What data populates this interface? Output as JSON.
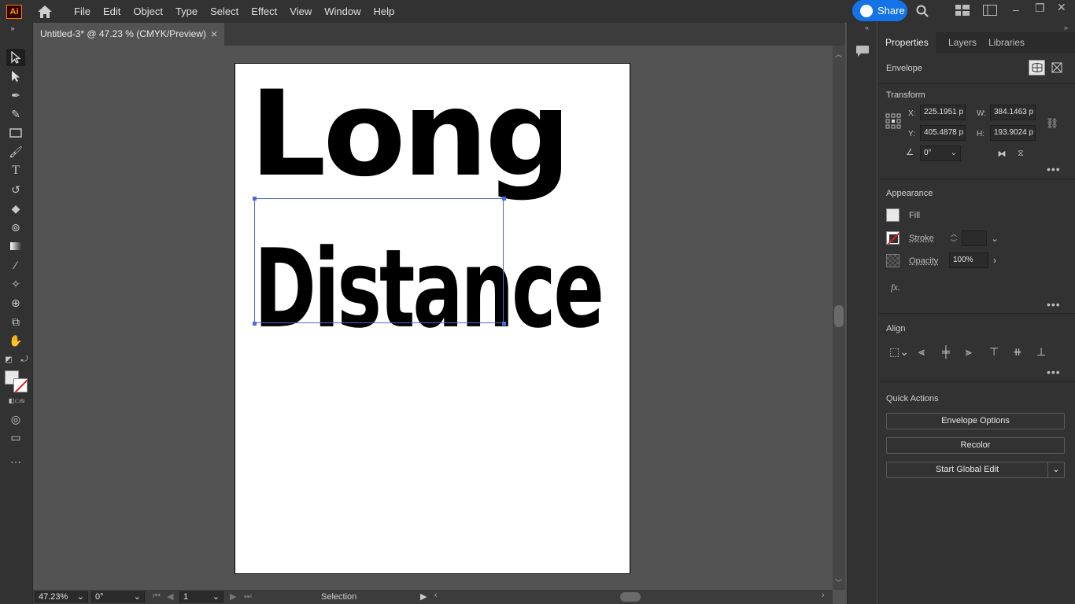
{
  "app": {
    "logo": "Ai"
  },
  "menu": [
    "File",
    "Edit",
    "Object",
    "Type",
    "Select",
    "Effect",
    "View",
    "Window",
    "Help"
  ],
  "share_label": "Share",
  "document_tab": {
    "title": "Untitled-3* @ 47.23 % (CMYK/Preview)",
    "close": "×"
  },
  "artwork": {
    "line1": "Long",
    "line2": "Distance"
  },
  "status": {
    "zoom": "47.23%",
    "rotation": "0°",
    "artboard": "1",
    "tool": "Selection"
  },
  "panel": {
    "tabs": [
      "Properties",
      "Layers",
      "Libraries"
    ],
    "envelope_label": "Envelope",
    "transform": {
      "title": "Transform",
      "x_label": "X:",
      "x": "225.1951 p",
      "y_label": "Y:",
      "y": "405.4878 p",
      "w_label": "W:",
      "w": "384.1463 p",
      "h_label": "H:",
      "h": "193.9024 p",
      "angle": "0°"
    },
    "appearance": {
      "title": "Appearance",
      "fill_label": "Fill",
      "stroke_label": "Stroke",
      "opacity_label": "Opacity",
      "opacity": "100%",
      "fx": "fx."
    },
    "align": {
      "title": "Align"
    },
    "quick_actions": {
      "title": "Quick Actions",
      "envelope_options": "Envelope Options",
      "recolor": "Recolor",
      "start_global_edit": "Start Global Edit"
    }
  },
  "colors": {
    "accent": "#1473e6",
    "selection": "#4a6cd4",
    "logo_orange": "#ff9a00"
  }
}
